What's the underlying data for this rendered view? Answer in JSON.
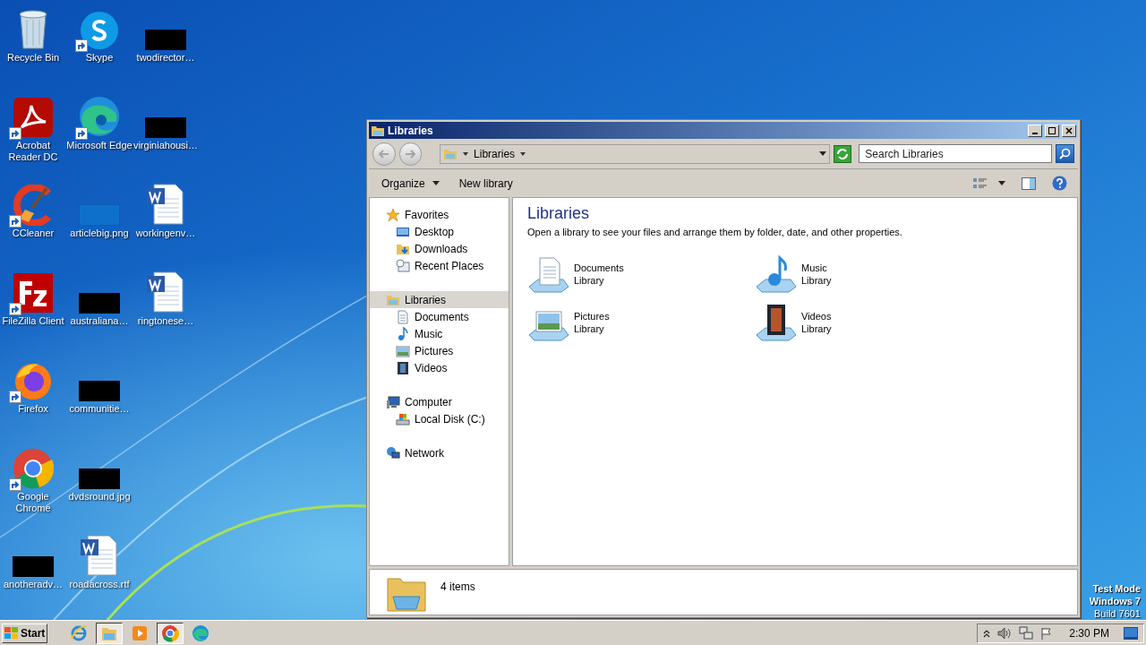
{
  "desktop_icons": [
    {
      "label": "Recycle Bin",
      "kind": "recycle",
      "shortcut": false
    },
    {
      "label": "Acrobat Reader DC",
      "kind": "pdf",
      "shortcut": true
    },
    {
      "label": "CCleaner",
      "kind": "ccleaner",
      "shortcut": true
    },
    {
      "label": "FileZilla Client",
      "kind": "filezilla",
      "shortcut": true
    },
    {
      "label": "Firefox",
      "kind": "firefox",
      "shortcut": true
    },
    {
      "label": "Google Chrome",
      "kind": "chrome",
      "shortcut": true
    },
    {
      "label": "anotheradv…",
      "kind": "redacted",
      "shortcut": false
    },
    {
      "label": "Skype",
      "kind": "skype",
      "shortcut": true
    },
    {
      "label": "Microsoft Edge",
      "kind": "edge",
      "shortcut": true
    },
    {
      "label": "articlebig.png",
      "kind": "blank",
      "shortcut": false
    },
    {
      "label": "australiana…",
      "kind": "redacted",
      "shortcut": false
    },
    {
      "label": "communitie…",
      "kind": "redacted",
      "shortcut": false
    },
    {
      "label": "dvdsround.jpg",
      "kind": "redacted",
      "shortcut": false
    },
    {
      "label": "roadacross.rtf",
      "kind": "word",
      "shortcut": false
    },
    {
      "label": "twodirector…",
      "kind": "redacted",
      "shortcut": false
    },
    {
      "label": "virginiahousi…",
      "kind": "redacted",
      "shortcut": false
    },
    {
      "label": "workingenv…",
      "kind": "word",
      "shortcut": false
    },
    {
      "label": "ringtonese…",
      "kind": "word",
      "shortcut": false
    }
  ],
  "window": {
    "title": "Libraries",
    "address": {
      "crumb": "Libraries"
    },
    "search": {
      "placeholder": "Search Libraries"
    },
    "toolbar": [
      "Organize",
      "New library"
    ],
    "nav": [
      {
        "label": "Favorites",
        "kind": "star",
        "selected": false,
        "children": [
          {
            "label": "Desktop",
            "kind": "desktop",
            "selected": false
          },
          {
            "label": "Downloads",
            "kind": "downloads",
            "selected": false
          },
          {
            "label": "Recent Places",
            "kind": "recent",
            "selected": false
          }
        ]
      },
      {
        "label": "Libraries",
        "kind": "library",
        "selected": true,
        "children": [
          {
            "label": "Documents",
            "kind": "documents",
            "selected": false
          },
          {
            "label": "Music",
            "kind": "music",
            "selected": false
          },
          {
            "label": "Pictures",
            "kind": "pictures",
            "selected": false
          },
          {
            "label": "Videos",
            "kind": "videos",
            "selected": false
          }
        ]
      },
      {
        "label": "Computer",
        "kind": "computer",
        "selected": false,
        "children": [
          {
            "label": "Local Disk (C:)",
            "kind": "disk",
            "selected": false
          }
        ]
      },
      {
        "label": "Network",
        "kind": "network",
        "selected": false
      }
    ],
    "heading": "Libraries",
    "description": "Open a library to see your files and arrange them by folder, date, and other properties.",
    "libraries": [
      {
        "name": "Documents",
        "type": "Library",
        "kind": "documents"
      },
      {
        "name": "Music",
        "type": "Library",
        "kind": "music"
      },
      {
        "name": "Pictures",
        "type": "Library",
        "kind": "pictures"
      },
      {
        "name": "Videos",
        "type": "Library",
        "kind": "videos"
      }
    ],
    "status": "4 items"
  },
  "watermark_os": [
    "Test Mode",
    "Windows 7",
    "Build 7601"
  ],
  "taskbar": {
    "start": "Start",
    "items": [
      {
        "kind": "ie",
        "running": false
      },
      {
        "kind": "explorer",
        "running": true
      },
      {
        "kind": "media",
        "running": false
      },
      {
        "kind": "chrome",
        "running": true
      },
      {
        "kind": "edge",
        "running": false
      }
    ],
    "clock": "2:30 PM"
  }
}
